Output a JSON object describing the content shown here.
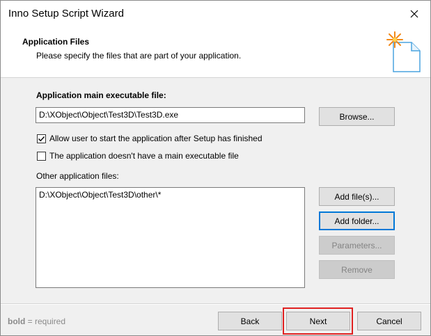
{
  "window": {
    "title": "Inno Setup Script Wizard"
  },
  "header": {
    "title": "Application Files",
    "subtitle": "Please specify the files that are part of your application."
  },
  "main_exe": {
    "label": "Application main executable file:",
    "value": "D:\\XObject\\Object\\Test3D\\Test3D.exe",
    "browse_label": "Browse..."
  },
  "options": {
    "allow_start": {
      "label": "Allow user to start the application after Setup has finished",
      "checked": true
    },
    "no_main_exe": {
      "label": "The application doesn't have a main executable file",
      "checked": false
    }
  },
  "other_files": {
    "label": "Other application files:",
    "items": [
      "D:\\XObject\\Object\\Test3D\\other\\*"
    ],
    "buttons": {
      "add_files": "Add file(s)...",
      "add_folder": "Add folder...",
      "parameters": "Parameters...",
      "remove": "Remove"
    }
  },
  "footer": {
    "hint_bold": "bold",
    "hint_rest": " = required",
    "back": "Back",
    "next": "Next",
    "cancel": "Cancel"
  },
  "colors": {
    "accent": "#0078d7",
    "highlight": "#e02020",
    "disabled_text": "#838383"
  },
  "icons": {
    "close": "close-icon",
    "wizard": "wizard-document-icon",
    "check": "checkmark-icon"
  }
}
